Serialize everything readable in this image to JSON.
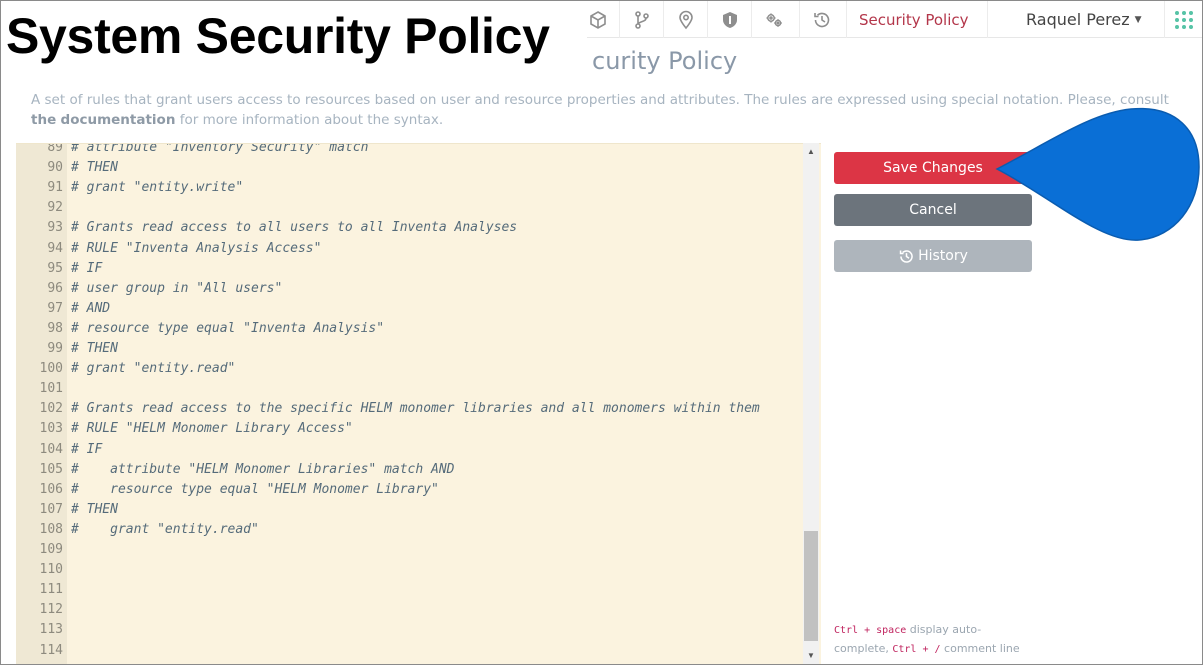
{
  "overlay": {
    "title": "System Security Policy"
  },
  "nav": {
    "icons": [
      "cube-icon",
      "git-branch-icon",
      "map-pin-icon",
      "shield-icon",
      "gears-icon",
      "history-icon"
    ],
    "active_item": "Security Policy",
    "user_name": "Raquel Perez"
  },
  "page": {
    "heading_visible": "curity Policy",
    "description_part1": "A set of rules that grant users access to resources based on user and resource properties and attributes. The rules are expressed using special notation. Please, consult ",
    "description_link_a": "the",
    "description_link_b": "documentation",
    "description_part2": " for more information about the syntax."
  },
  "editor": {
    "lines": [
      {
        "n": "89",
        "text": "# attribute \"Inventory Security\" match"
      },
      {
        "n": "90",
        "text": "# THEN"
      },
      {
        "n": "91",
        "text": "# grant \"entity.write\""
      },
      {
        "n": "92",
        "text": ""
      },
      {
        "n": "93",
        "text": "# Grants read access to all users to all Inventa Analyses"
      },
      {
        "n": "94",
        "text": "# RULE \"Inventa Analysis Access\""
      },
      {
        "n": "95",
        "text": "# IF"
      },
      {
        "n": "96",
        "text": "# user group in \"All users\""
      },
      {
        "n": "97",
        "text": "# AND"
      },
      {
        "n": "98",
        "text": "# resource type equal \"Inventa Analysis\""
      },
      {
        "n": "99",
        "text": "# THEN"
      },
      {
        "n": "100",
        "text": "# grant \"entity.read\""
      },
      {
        "n": "101",
        "text": ""
      },
      {
        "n": "102",
        "text": "# Grants read access to the specific HELM monomer libraries and all monomers within them"
      },
      {
        "n": "103",
        "text": "# RULE \"HELM Monomer Library Access\""
      },
      {
        "n": "104",
        "text": "# IF"
      },
      {
        "n": "105",
        "text": "#    attribute \"HELM Monomer Libraries\" match AND"
      },
      {
        "n": "106",
        "text": "#    resource type equal \"HELM Monomer Library\""
      },
      {
        "n": "107",
        "text": "# THEN"
      },
      {
        "n": "108",
        "text": "#    grant \"entity.read\""
      },
      {
        "n": "109",
        "text": ""
      },
      {
        "n": "110",
        "text": ""
      },
      {
        "n": "111",
        "text": ""
      },
      {
        "n": "112",
        "text": ""
      },
      {
        "n": "113",
        "text": ""
      },
      {
        "n": "114",
        "text": ""
      }
    ]
  },
  "actions": {
    "save_label": "Save Changes",
    "cancel_label": "Cancel",
    "history_label": "History"
  },
  "hint": {
    "key1": "Ctrl + space",
    "text1": " display auto-complete, ",
    "key2": "Ctrl + /",
    "text2": " comment line"
  },
  "colors": {
    "save": "#dc3545",
    "cancel": "#6c747c",
    "history": "#aeb5bc",
    "editor_bg": "#fbf3df",
    "callout": "#0a6fd6",
    "active_nav": "#b3364a"
  }
}
